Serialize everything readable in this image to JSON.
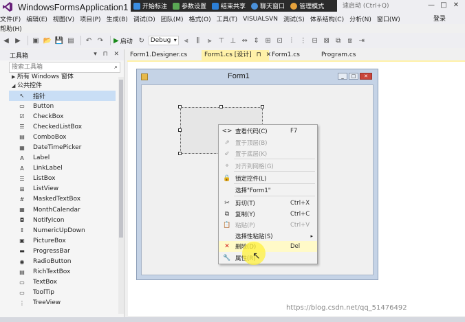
{
  "window": {
    "title": "WindowsFormsApplication1 - Mic",
    "quick_launch": "速启动 (Ctrl+Q)",
    "controls": [
      "—",
      "□",
      "✕"
    ]
  },
  "overlay_toolbar": {
    "items": [
      "开始标注",
      "参数设置",
      "结束共享",
      "聊天窗口",
      "管理模式"
    ]
  },
  "menu": {
    "items": [
      "文件(F)",
      "编辑(E)",
      "视图(V)",
      "项目(P)",
      "生成(B)",
      "调试(D)",
      "团队(M)",
      "格式(O)",
      "工具(T)",
      "VISUALSVN",
      "测试(S)",
      "体系结构(C)",
      "分析(N)",
      "窗口(W)"
    ],
    "help": "帮助(H)",
    "login": "登录"
  },
  "toolbar": {
    "start_label": "启动",
    "config_value": "Debug"
  },
  "toolbox": {
    "title": "工具箱",
    "header_icons": "▾ ⊓ ✕",
    "search_placeholder": "搜索工具箱",
    "groups": [
      {
        "label": "所有 Windows 窗体",
        "expanded": false
      },
      {
        "label": "公共控件",
        "expanded": true
      }
    ],
    "items": [
      {
        "label": "指针",
        "icon": "pointer-icon",
        "glyph": "↖"
      },
      {
        "label": "Button",
        "icon": "button-icon",
        "glyph": "▭"
      },
      {
        "label": "CheckBox",
        "icon": "checkbox-icon",
        "glyph": "☑"
      },
      {
        "label": "CheckedListBox",
        "icon": "checkedlistbox-icon",
        "glyph": "☰"
      },
      {
        "label": "ComboBox",
        "icon": "combobox-icon",
        "glyph": "▤"
      },
      {
        "label": "DateTimePicker",
        "icon": "datetimepicker-icon",
        "glyph": "▦"
      },
      {
        "label": "Label",
        "icon": "label-icon",
        "glyph": "A"
      },
      {
        "label": "LinkLabel",
        "icon": "linklabel-icon",
        "glyph": "A"
      },
      {
        "label": "ListBox",
        "icon": "listbox-icon",
        "glyph": "☰"
      },
      {
        "label": "ListView",
        "icon": "listview-icon",
        "glyph": "⊞"
      },
      {
        "label": "MaskedTextBox",
        "icon": "maskedtextbox-icon",
        "glyph": "#"
      },
      {
        "label": "MonthCalendar",
        "icon": "monthcalendar-icon",
        "glyph": "▦"
      },
      {
        "label": "NotifyIcon",
        "icon": "notifyicon-icon",
        "glyph": "◘"
      },
      {
        "label": "NumericUpDown",
        "icon": "numericupdown-icon",
        "glyph": "⇕"
      },
      {
        "label": "PictureBox",
        "icon": "picturebox-icon",
        "glyph": "▣"
      },
      {
        "label": "ProgressBar",
        "icon": "progressbar-icon",
        "glyph": "▬"
      },
      {
        "label": "RadioButton",
        "icon": "radiobutton-icon",
        "glyph": "◉"
      },
      {
        "label": "RichTextBox",
        "icon": "richtextbox-icon",
        "glyph": "▤"
      },
      {
        "label": "TextBox",
        "icon": "textbox-icon",
        "glyph": "▭"
      },
      {
        "label": "ToolTip",
        "icon": "tooltip-icon",
        "glyph": "▭"
      },
      {
        "label": "TreeView",
        "icon": "treeview-icon",
        "glyph": "⋮"
      }
    ]
  },
  "tabs": [
    {
      "label": "Form1.Designer.cs",
      "active": false
    },
    {
      "label": "Form1.cs [设计]",
      "active": true,
      "pin": "⊓",
      "close": "✕"
    },
    {
      "label": "Form1.cs",
      "active": false
    },
    {
      "label": "Program.cs",
      "active": false
    }
  ],
  "form": {
    "caption": "Form1"
  },
  "context_menu": {
    "items": [
      {
        "label": "查看代码(C)",
        "shortcut": "F7",
        "icon": "code-icon",
        "glyph": "<>",
        "disabled": false
      },
      {
        "label": "置于顶层(B)",
        "shortcut": "",
        "icon": "bring-front-icon",
        "glyph": "⇗",
        "disabled": true
      },
      {
        "label": "置于底层(K)",
        "shortcut": "",
        "icon": "send-back-icon",
        "glyph": "⇙",
        "disabled": true
      },
      {
        "label": "对齐到网格(G)",
        "shortcut": "",
        "icon": "align-grid-icon",
        "glyph": "⌖",
        "disabled": true
      },
      {
        "label": "锁定控件(L)",
        "shortcut": "",
        "icon": "lock-icon",
        "glyph": "🔒",
        "disabled": false
      },
      {
        "label": "选择\"Form1\"",
        "shortcut": "",
        "icon": "",
        "glyph": "",
        "disabled": false
      },
      {
        "label": "剪切(T)",
        "shortcut": "Ctrl+X",
        "icon": "cut-icon",
        "glyph": "✂",
        "disabled": false
      },
      {
        "label": "复制(Y)",
        "shortcut": "Ctrl+C",
        "icon": "copy-icon",
        "glyph": "⧉",
        "disabled": false
      },
      {
        "label": "粘贴(P)",
        "shortcut": "Ctrl+V",
        "icon": "paste-icon",
        "glyph": "📋",
        "disabled": true
      },
      {
        "label": "选择性粘贴(S)",
        "shortcut": "",
        "icon": "",
        "glyph": "",
        "disabled": false,
        "submenu": "▸"
      },
      {
        "label": "删除(D)",
        "shortcut": "Del",
        "icon": "delete-icon",
        "glyph": "✕",
        "disabled": false,
        "hover": true
      },
      {
        "label": "属性(R)",
        "shortcut": "",
        "icon": "properties-icon",
        "glyph": "🔧",
        "disabled": false
      }
    ]
  },
  "watermark": "https://blog.csdn.net/qq_51476492",
  "colors": {
    "accent": "#fff1a8",
    "selection": "#c9def5",
    "delete": "#d11a1a"
  }
}
